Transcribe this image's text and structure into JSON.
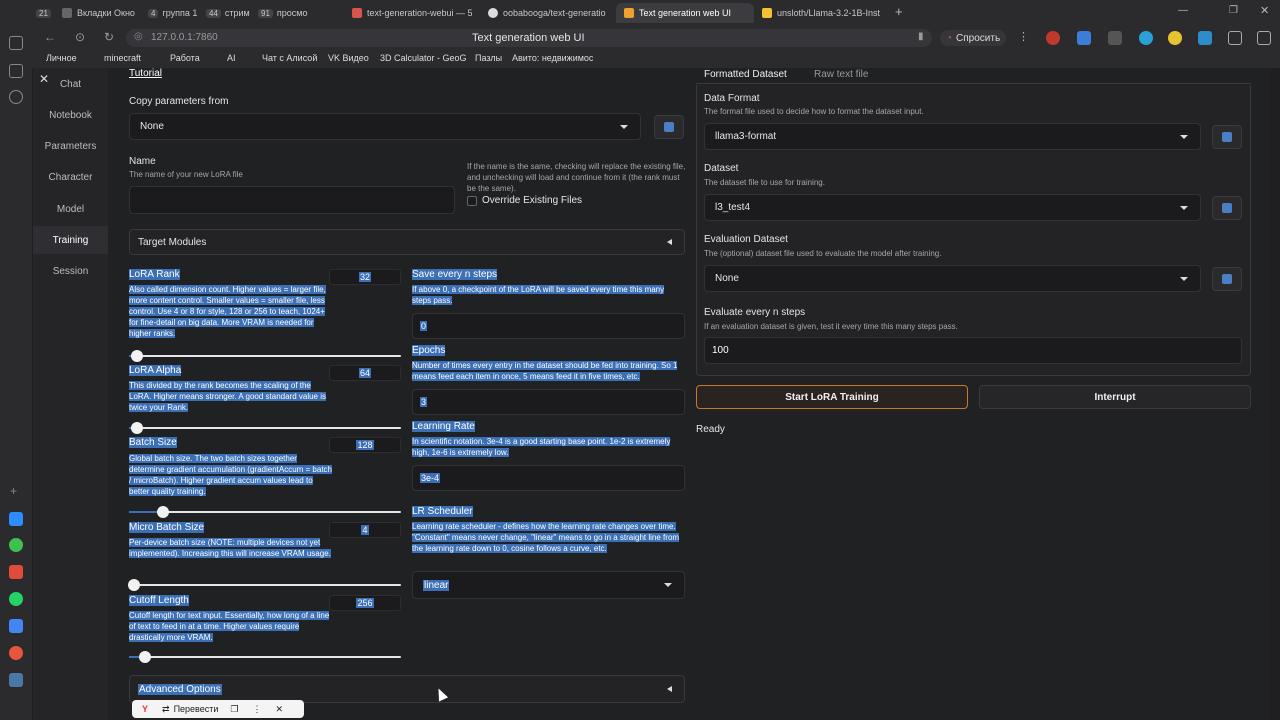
{
  "browser": {
    "tabs": [
      {
        "count": "21",
        "label": ""
      },
      {
        "count": "",
        "label": "Вкладки Окно"
      },
      {
        "count": "4",
        "label": "группа 1"
      },
      {
        "count": "44",
        "label": "стрим"
      },
      {
        "count": "91",
        "label": "просмо"
      },
      {
        "count": "",
        "label": "text-generation-webui — 5"
      },
      {
        "count": "",
        "label": "oobabooga/text-generatio"
      },
      {
        "count": "",
        "label": "Text generation web UI"
      },
      {
        "count": "",
        "label": "unsloth/Llama-3.2-1B-Inst"
      }
    ],
    "url": "127.0.0.1:7860",
    "page_title": "Text generation web UI",
    "ask_button": "Спросить",
    "bookmarks": [
      "Личное",
      "minecraft",
      "Работа",
      "AI",
      "Чат с Алисой",
      "VK Видео",
      "3D Calculator - GeoG",
      "Пазлы",
      "Авито: недвижимос"
    ]
  },
  "sidenav": {
    "items": [
      "Chat",
      "Notebook",
      "Parameters",
      "Character",
      "Model",
      "Training",
      "Session"
    ],
    "active": "Training"
  },
  "left": {
    "tutorial_link": "Tutorial",
    "copy_params_label": "Copy parameters from",
    "copy_params_value": "None",
    "name_label": "Name",
    "name_info": "The name of your new LoRA file",
    "name_value": "",
    "override_info": "If the name is the same, checking will replace the existing file, and unchecking will load and continue from it (the rank must be the same).",
    "override_label": "Override Existing Files",
    "target_modules": "Target Modules",
    "lora_rank": {
      "label": "LoRA Rank",
      "value": "32",
      "info": "Also called dimension count. Higher values = larger file, more content control. Smaller values = smaller file, less control. Use 4 or 8 for style, 128 or 256 to teach, 1024+ for fine-detail on big data. More VRAM is needed for higher ranks.",
      "fraction": 0.03
    },
    "lora_alpha": {
      "label": "LoRA Alpha",
      "value": "64",
      "info": "This divided by the rank becomes the scaling of the LoRA. Higher means stronger. A good standard value is twice your Rank.",
      "fraction": 0.03
    },
    "batch_size": {
      "label": "Batch Size",
      "value": "128",
      "info": "Global batch size. The two batch sizes together determine gradient accumulation (gradientAccum = batch / microBatch). Higher gradient accum values lead to better quality training.",
      "fraction": 0.125
    },
    "micro_batch_size": {
      "label": "Micro Batch Size",
      "value": "4",
      "info": "Per-device batch size (NOTE: multiple devices not yet implemented). Increasing this will increase VRAM usage.",
      "fraction": 0.02
    },
    "cutoff_length": {
      "label": "Cutoff Length",
      "value": "256",
      "info": "Cutoff length for text input. Essentially, how long of a line of text to feed in at a time. Higher values require drastically more VRAM.",
      "fraction": 0.06
    },
    "save_steps": {
      "label": "Save every n steps",
      "info": "If above 0, a checkpoint of the LoRA will be saved every time this many steps pass.",
      "value": "0"
    },
    "epochs": {
      "label": "Epochs",
      "info": "Number of times every entry in the dataset should be fed into training. So 1 means feed each item in once, 5 means feed it in five times, etc.",
      "value": "3"
    },
    "learning_rate": {
      "label": "Learning Rate",
      "info": "In scientific notation. 3e-4 is a good starting base point. 1e-2 is extremely high, 1e-6 is extremely low.",
      "value": "3e-4"
    },
    "lr_scheduler": {
      "label": "LR Scheduler",
      "info": "Learning rate scheduler - defines how the learning rate changes over time. \"Constant\" means never change, \"linear\" means to go in a straight line from the learning rate down to 0, cosine follows a curve, etc.",
      "value": "linear"
    },
    "advanced_options": "Advanced Options"
  },
  "right": {
    "tabs": [
      "Formatted Dataset",
      "Raw text file"
    ],
    "data_format": {
      "label": "Data Format",
      "info": "The format file used to decide how to format the dataset input.",
      "value": "llama3-format"
    },
    "dataset": {
      "label": "Dataset",
      "info": "The dataset file to use for training.",
      "value": "l3_test4"
    },
    "eval_dataset": {
      "label": "Evaluation Dataset",
      "info": "The (optional) dataset file used to evaluate the model after training.",
      "value": "None"
    },
    "eval_steps": {
      "label": "Evaluate every n steps",
      "info": "If an evaluation dataset is given, test it every time this many steps pass.",
      "value": "100"
    },
    "start_button": "Start LoRA Training",
    "interrupt_button": "Interrupt",
    "status": "Ready"
  },
  "translate_popup": {
    "label": "Перевести"
  }
}
